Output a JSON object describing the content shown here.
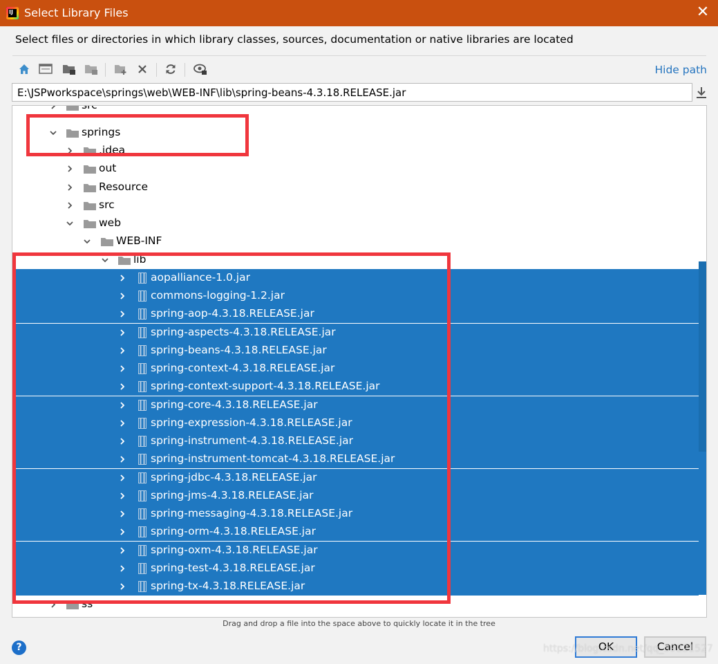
{
  "window": {
    "title": "Select Library Files",
    "close_glyph": "✕",
    "app_icon_text": "IJ"
  },
  "description": "Select files or directories in which library classes, sources, documentation or native libraries are located",
  "toolbar": {
    "icons": [
      "home-icon",
      "desktop-icon",
      "project-folder-icon",
      "module-folder-icon",
      "new-folder-icon",
      "delete-icon",
      "refresh-icon",
      "show-hidden-icon"
    ],
    "hide_path": "Hide path"
  },
  "path": {
    "value": "E:\\JSPworkspace\\springs\\web\\WEB-INF\\lib\\spring-beans-4.3.18.RELEASE.jar"
  },
  "tree": {
    "top_partial": "src",
    "bottom_partial": "ss",
    "springs": "springs",
    "idea": ".idea",
    "out": "out",
    "resource": "Resource",
    "src": "src",
    "web": "web",
    "webinf": "WEB-INF",
    "lib": "lib",
    "jars": [
      "aopalliance-1.0.jar",
      "commons-logging-1.2.jar",
      "spring-aop-4.3.18.RELEASE.jar",
      "spring-aspects-4.3.18.RELEASE.jar",
      "spring-beans-4.3.18.RELEASE.jar",
      "spring-context-4.3.18.RELEASE.jar",
      "spring-context-support-4.3.18.RELEASE.jar",
      "spring-core-4.3.18.RELEASE.jar",
      "spring-expression-4.3.18.RELEASE.jar",
      "spring-instrument-4.3.18.RELEASE.jar",
      "spring-instrument-tomcat-4.3.18.RELEASE.jar",
      "spring-jdbc-4.3.18.RELEASE.jar",
      "spring-jms-4.3.18.RELEASE.jar",
      "spring-messaging-4.3.18.RELEASE.jar",
      "spring-orm-4.3.18.RELEASE.jar",
      "spring-oxm-4.3.18.RELEASE.jar",
      "spring-test-4.3.18.RELEASE.jar",
      "spring-tx-4.3.18.RELEASE.jar"
    ]
  },
  "hint": "Drag and drop a file into the space above to quickly locate it in the tree",
  "buttons": {
    "help": "?",
    "ok": "OK",
    "cancel": "Cancel"
  },
  "watermark": "https://blog.csdn.net/qq_39221527",
  "colors": {
    "titlebar": "#c9500f",
    "selection": "#1f78c1",
    "annotation": "#f0363d",
    "link": "#2675bf"
  }
}
